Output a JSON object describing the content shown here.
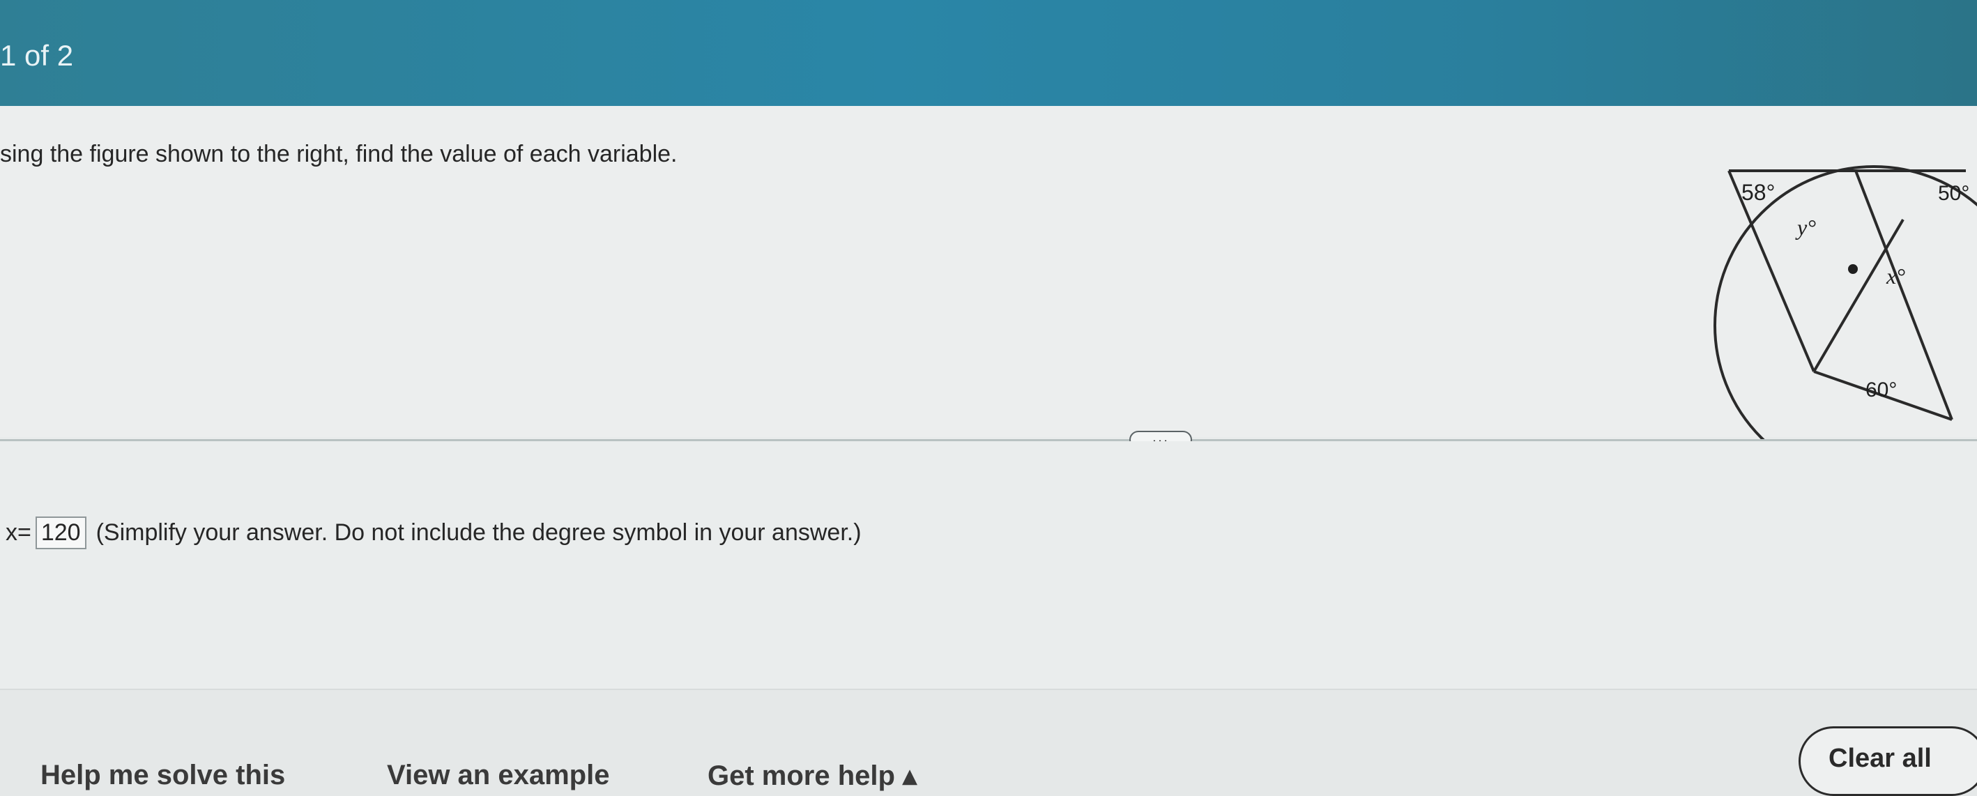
{
  "header": {
    "question_counter": "1 of 2"
  },
  "problem": {
    "instruction": "sing the figure shown to the right, find the value of each variable.",
    "figure": {
      "label_top_left": "58°",
      "label_y": "y°",
      "label_top_right": "50°",
      "label_x": "x°",
      "label_bottom": "60°"
    }
  },
  "divider": {
    "more_button": "..."
  },
  "answer": {
    "variable_label": "x=",
    "value": "120",
    "instruction": "(Simplify your answer. Do not include the degree symbol in your answer.)"
  },
  "footer": {
    "help_me_solve": "Help me solve this",
    "view_example": "View an example",
    "get_more_help": "Get more help ▴",
    "clear_all": "Clear all"
  }
}
